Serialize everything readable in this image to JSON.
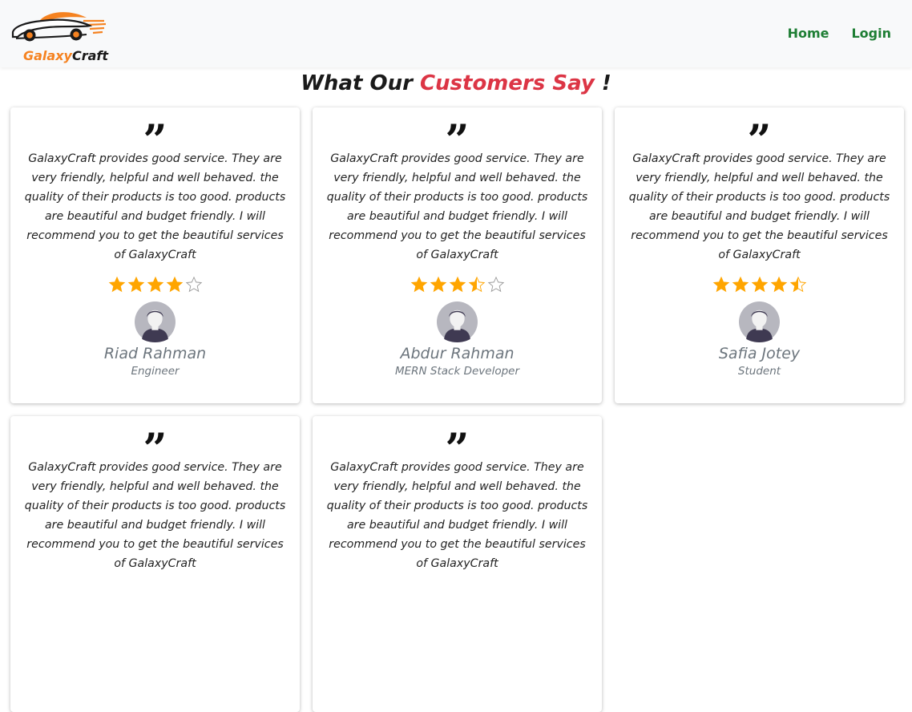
{
  "brand": {
    "name_part1": "Galaxy",
    "name_part2": "Craft",
    "primary_color": "#f58220",
    "dark_color": "#1a1a1a"
  },
  "nav": {
    "links": [
      {
        "label": "Home"
      },
      {
        "label": "Login"
      }
    ],
    "link_color": "#1e7e34"
  },
  "heading": {
    "part1": "What Our ",
    "accent": "Customers Say",
    "part3": " !",
    "accent_color": "#dc3545"
  },
  "star_color": "#ffa500",
  "testimonials": [
    {
      "text": "GalaxyCraft provides good service. They are very friendly, helpful and well behaved. the quality of their products is too good. products are beautiful and budget friendly. I will recommend you to get the beautiful services of GalaxyCraft",
      "rating": 4,
      "name": "Riad Rahman",
      "role": "Engineer"
    },
    {
      "text": "GalaxyCraft provides good service. They are very friendly, helpful and well behaved. the quality of their products is too good. products are beautiful and budget friendly. I will recommend you to get the beautiful services of GalaxyCraft",
      "rating": 3.5,
      "name": "Abdur Rahman",
      "role": "MERN Stack Developer"
    },
    {
      "text": "GalaxyCraft provides good service. They are very friendly, helpful and well behaved. the quality of their products is too good. products are beautiful and budget friendly. I will recommend you to get the beautiful services of GalaxyCraft",
      "rating": 4.5,
      "name": "Safia Jotey",
      "role": "Student"
    },
    {
      "text": "GalaxyCraft provides good service. They are very friendly, helpful and well behaved. the quality of their products is too good. products are beautiful and budget friendly. I will recommend you to get the beautiful services of GalaxyCraft"
    },
    {
      "text": "GalaxyCraft provides good service. They are very friendly, helpful and well behaved. the quality of their products is too good. products are beautiful and budget friendly. I will recommend you to get the beautiful services of GalaxyCraft"
    }
  ]
}
